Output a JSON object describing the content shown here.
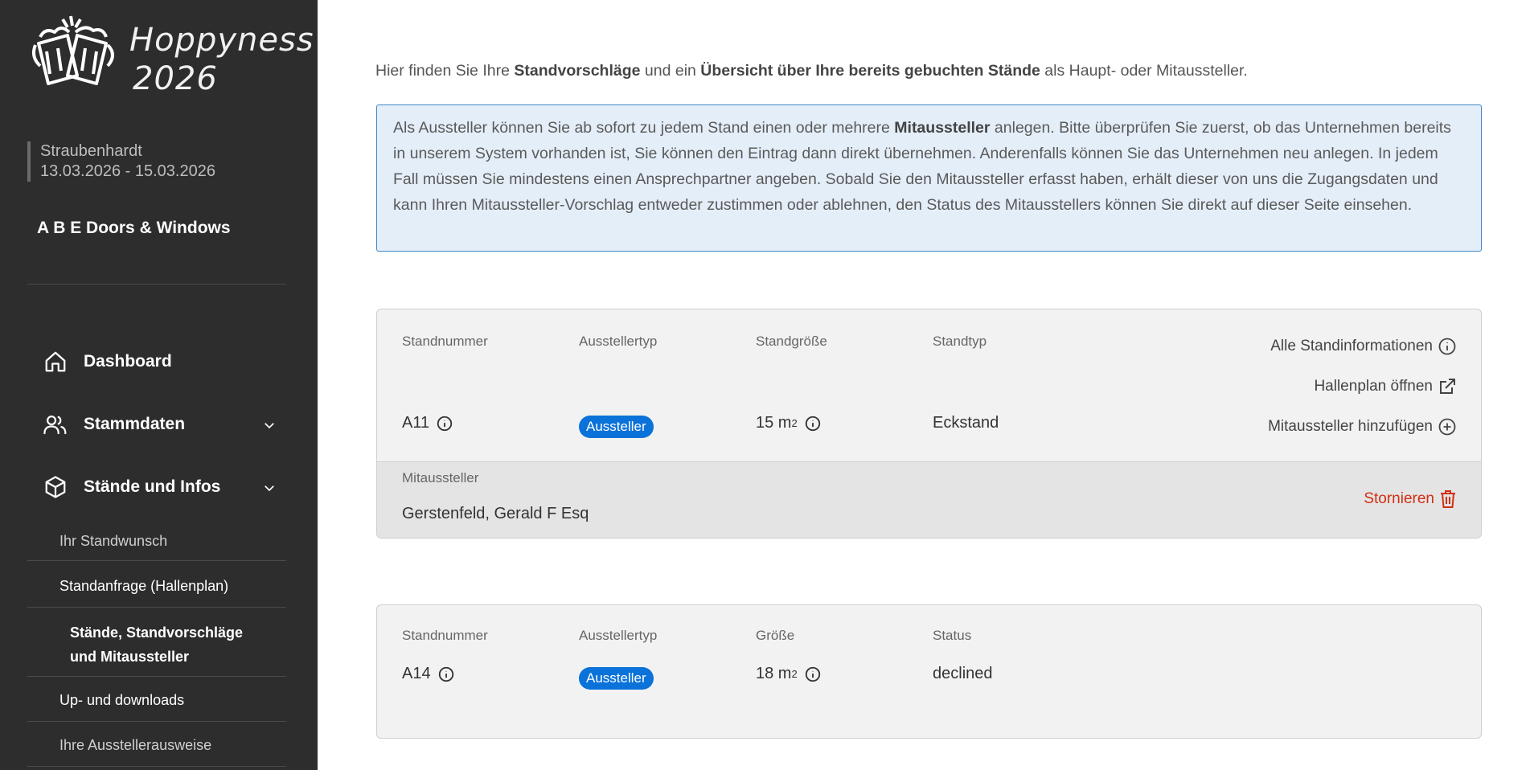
{
  "brand": {
    "line1": "Hoppyness",
    "line2": "2026"
  },
  "event": {
    "location": "Straubenhardt",
    "dates": "13.03.2026 - 15.03.2026"
  },
  "company": "A B E Doors & Windows",
  "nav": {
    "dashboard": "Dashboard",
    "stammdaten": "Stammdaten",
    "staende": "Stände und Infos",
    "sub": {
      "standwunsch": "Ihr Standwunsch",
      "standanfrage": "Standanfrage (Hallenplan)",
      "active_line1": "Stände, Standvorschläge",
      "active_line2": "und Mitaussteller",
      "downloads": "Up- und downloads",
      "ausweise": "Ihre Ausstellerausweise"
    }
  },
  "intro": {
    "p1": "Hier finden Sie Ihre ",
    "b1": "Standvorschläge",
    "p2": " und ein ",
    "b2": "Übersicht über Ihre bereits gebuchten Stände",
    "p3": " als Haupt- oder Mitaussteller."
  },
  "info": {
    "p1": "Als Aussteller können Sie ab sofort zu jedem Stand einen oder mehrere ",
    "b1": "Mitaussteller",
    "p2": " anlegen. Bitte überprüfen Sie zuerst, ob das Unternehmen bereits in unserem System vorhanden ist, Sie können den Eintrag dann direkt übernehmen. Anderenfalls können Sie das Unternehmen neu anlegen. In jedem Fall müssen Sie mindestens einen Ansprechpartner angeben. Sobald Sie den Mitaussteller erfasst haben, erhält dieser von uns die Zugangsdaten und kann Ihren Mitaussteller-Vorschlag entweder zustimmen oder ablehnen, den Status des Mitausstellers können Sie direkt auf dieser Seite einsehen."
  },
  "stand1": {
    "headers": {
      "nr": "Standnummer",
      "typ": "Ausstellertyp",
      "size": "Standgröße",
      "standtyp": "Standtyp"
    },
    "nr": "A11",
    "badge": "Aussteller",
    "size": "15 m",
    "size_sup": "2",
    "standtyp": "Eckstand",
    "actions": {
      "info": "Alle Standinformationen",
      "plan": "Hallenplan öffnen",
      "add": "Mitaussteller hinzufügen"
    },
    "co_label": "Mitaussteller",
    "co_name": "Gerstenfeld, Gerald F Esq",
    "storno": "Stornieren"
  },
  "stand2": {
    "headers": {
      "nr": "Standnummer",
      "typ": "Ausstellertyp",
      "size": "Größe",
      "status": "Status"
    },
    "nr": "A14",
    "badge": "Aussteller",
    "size": "18 m",
    "size_sup": "2",
    "status": "declined"
  },
  "colors": {
    "sidebar": "#2d2d2d",
    "badge": "#0a72d9",
    "storno": "#d32f14",
    "info_bg": "#e4eef8",
    "info_border": "#3f86c8"
  }
}
